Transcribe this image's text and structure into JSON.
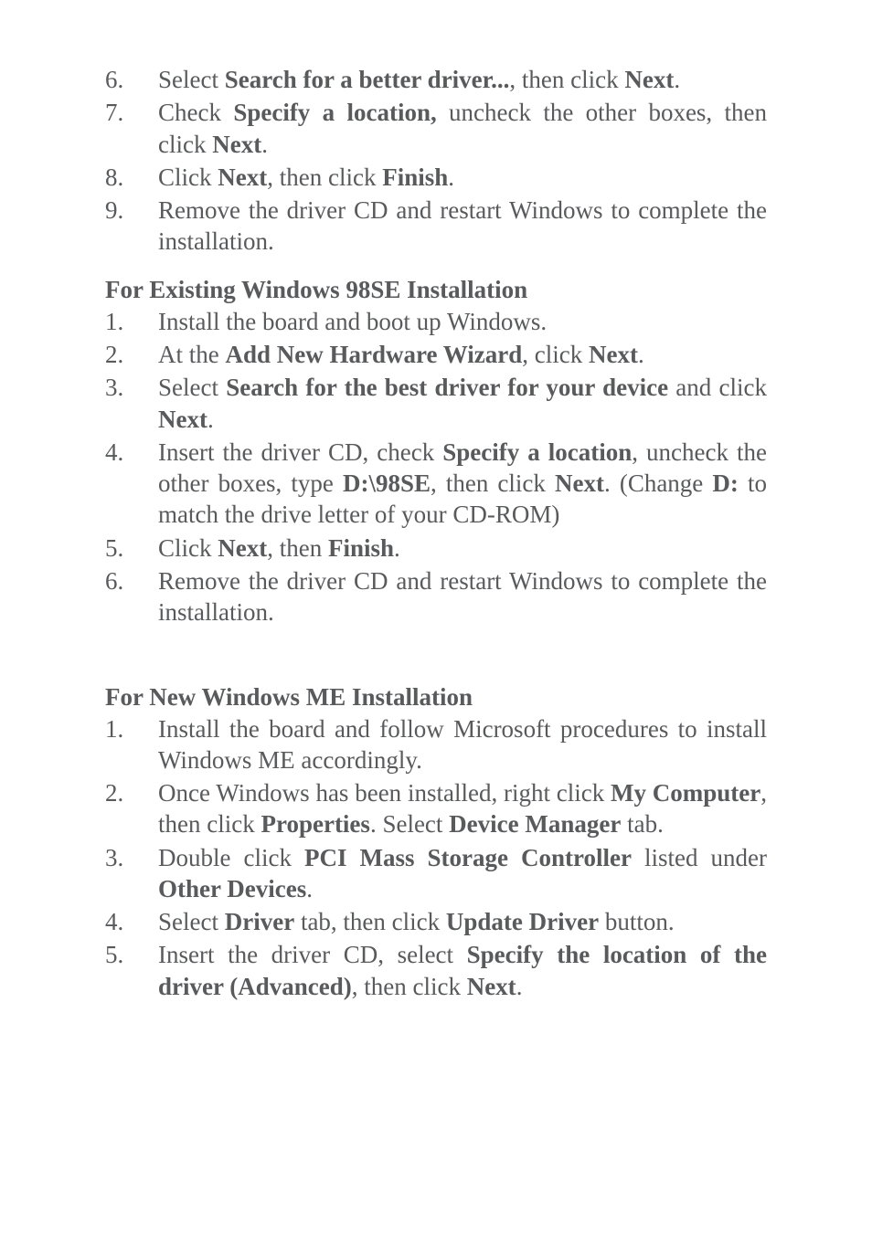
{
  "section1": {
    "items": [
      {
        "num": "6.",
        "html": "Select <b>Search for a better driver...</b>, then click <b>Next</b>."
      },
      {
        "num": "7.",
        "html": "Check <b>Specify a location,</b> uncheck the other boxes, then click <b>Next</b>."
      },
      {
        "num": "8.",
        "html": "Click <b>Next</b>, then click <b>Finish</b>."
      },
      {
        "num": "9.",
        "html": "Remove the driver CD and restart Windows to complete the installation."
      }
    ]
  },
  "section2": {
    "heading": "For Existing Windows 98SE Installation",
    "items": [
      {
        "num": "1.",
        "html": "Install the board and boot up Windows."
      },
      {
        "num": "2.",
        "html": "At the <b>Add New Hardware Wizard</b>, click <b>Next</b>."
      },
      {
        "num": "3.",
        "html": "Select <b>Search for the best driver for your device</b> and click <b>Next</b>."
      },
      {
        "num": "4.",
        "html": "Insert the driver CD, check <b>Specify a location</b>, uncheck the other boxes, type <b>D:\\98SE</b>, then click <b>Next</b>.  (Change <b>D:</b> to match the drive letter of your CD-ROM)"
      },
      {
        "num": "5.",
        "html": "Click <b>Next</b>, then <b>Finish</b>."
      },
      {
        "num": "6.",
        "html": "Remove the driver CD and restart Windows to complete the installation."
      }
    ]
  },
  "section3": {
    "heading": "For New Windows ME Installation",
    "items": [
      {
        "num": "1.",
        "html": "Install the board and follow Microsoft procedures to install Windows ME accordingly."
      },
      {
        "num": "2.",
        "html": "Once Windows has been installed, right click <b>My Computer</b>, then click <b>Properties</b>.  Select <b>Device Manager</b> tab."
      },
      {
        "num": "3.",
        "html": "Double click <b>PCI Mass Storage Controller</b> listed under <b>Other Devices</b>."
      },
      {
        "num": "4.",
        "html": "Select <b>Driver</b> tab, then click <b>Update Driver</b> button."
      },
      {
        "num": "5.",
        "html": "Insert the driver CD, select <b>Specify the location of the driver (Advanced)</b>, then click <b>Next</b>."
      }
    ]
  }
}
